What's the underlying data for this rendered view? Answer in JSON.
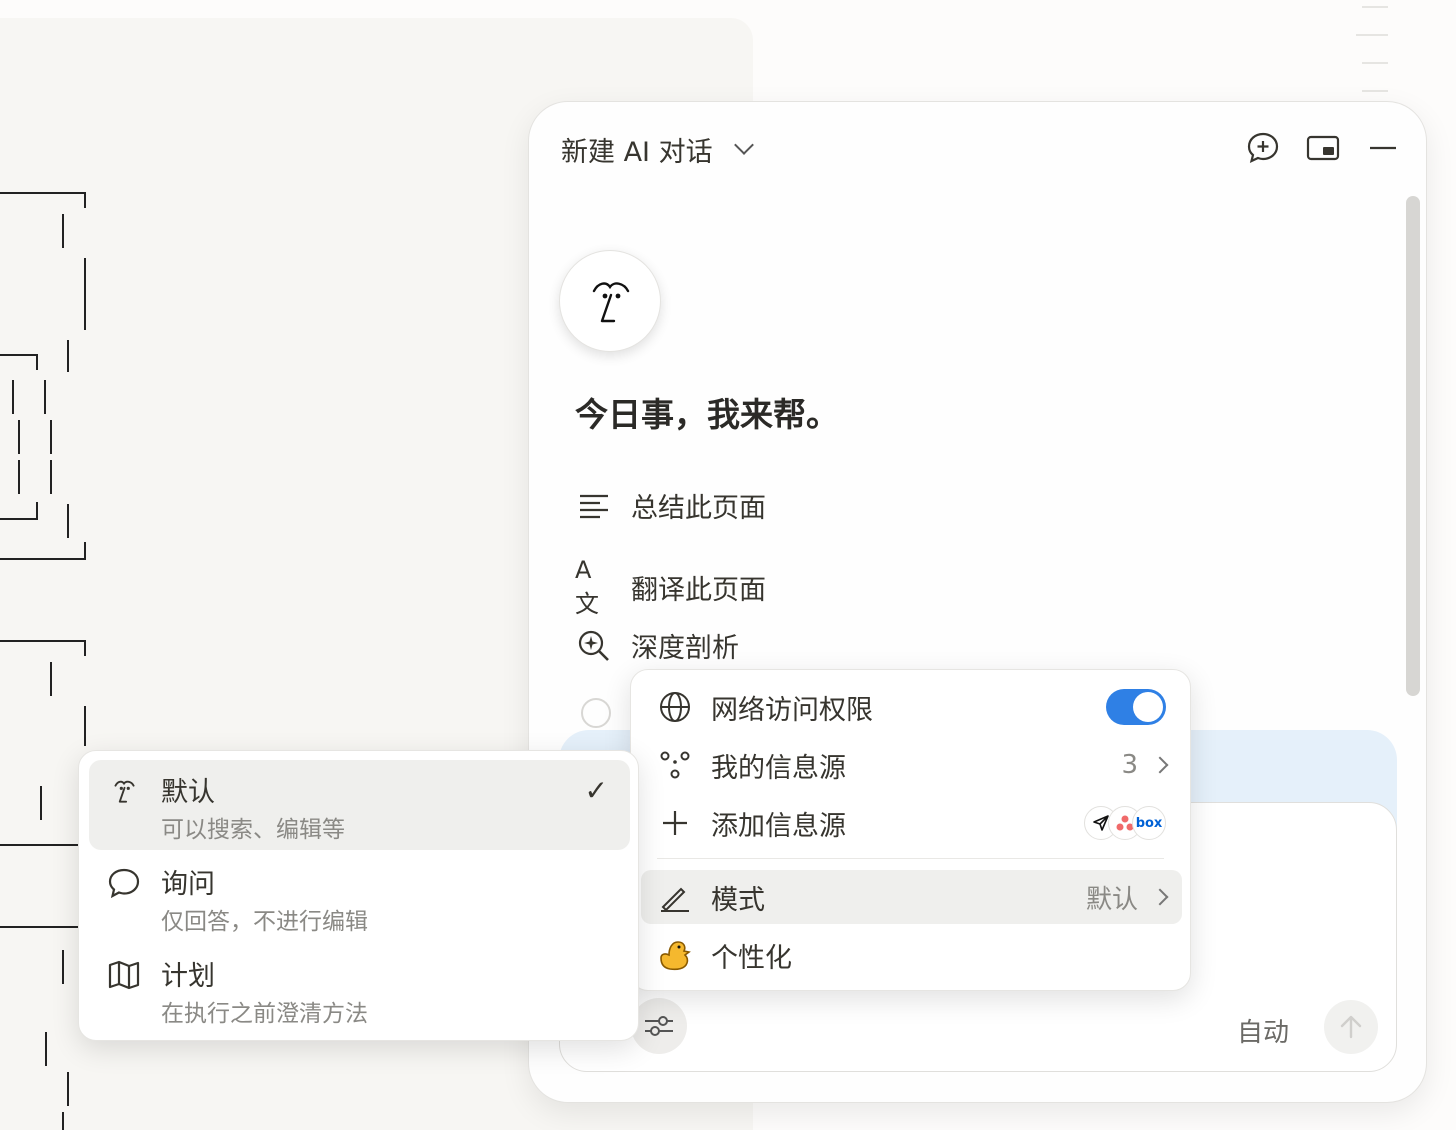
{
  "header": {
    "title": "新建 AI 对话",
    "icons": [
      "new-chat-icon",
      "picture-in-picture-icon",
      "minimize-icon"
    ]
  },
  "greeting": "今日事，我来帮。",
  "actions": [
    {
      "label": "总结此页面",
      "icon": "lines-icon"
    },
    {
      "label": "翻译此页面",
      "icon_text": "A文"
    },
    {
      "label": "深度剖析",
      "icon": "zoom-sparkle-icon"
    }
  ],
  "settings_menu": {
    "web_access": {
      "label": "网络访问权限",
      "enabled": true
    },
    "my_sources": {
      "label": "我的信息源",
      "count": "3"
    },
    "add_source": {
      "label": "添加信息源",
      "source_icons": [
        "send-icon",
        "asana-icon",
        "box-icon"
      ],
      "box_text": "box"
    },
    "mode": {
      "label": "模式",
      "value": "默认"
    },
    "personalize": {
      "label": "个性化",
      "icon": "duck-icon"
    }
  },
  "mode_menu": {
    "items": [
      {
        "title": "默认",
        "desc": "可以搜索、编辑等",
        "selected": true,
        "check": "✓"
      },
      {
        "title": "询问",
        "desc": "仅回答，不进行编辑",
        "selected": false
      },
      {
        "title": "计划",
        "desc": "在执行之前澄清方法",
        "selected": false
      }
    ]
  },
  "composer": {
    "model_label": "自动"
  },
  "colors": {
    "accent": "#2f80e5",
    "input_tint": "#e5f0fa"
  }
}
